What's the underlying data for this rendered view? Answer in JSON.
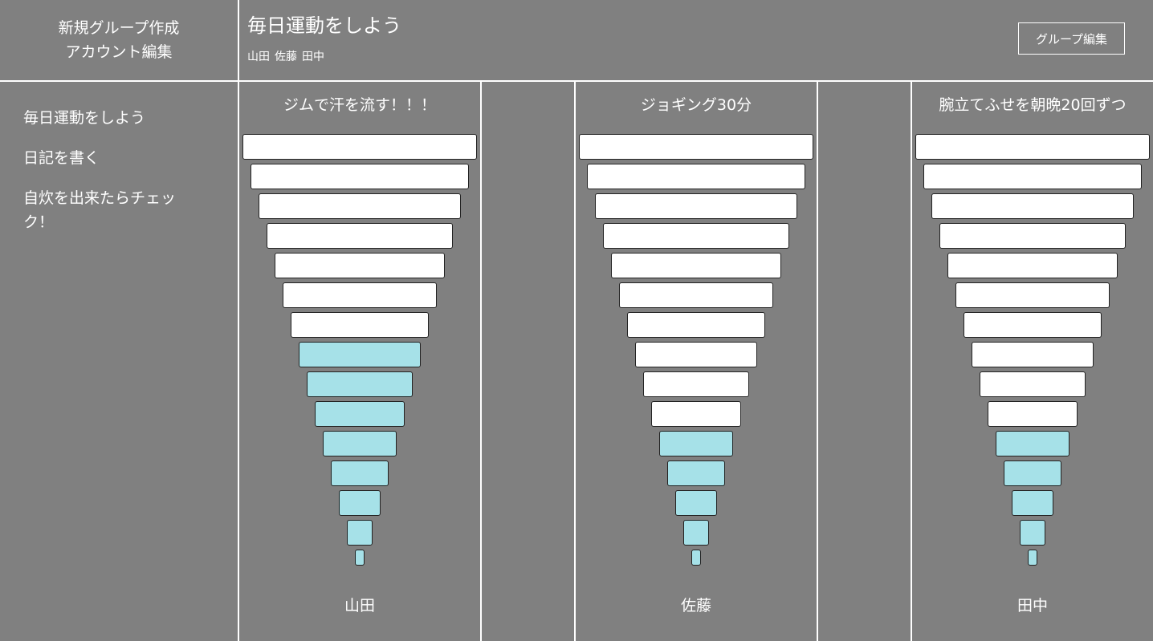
{
  "menu": {
    "new_group": "新規グループ作成",
    "account_edit": "アカウント編集"
  },
  "header": {
    "group_title": "毎日運動をしよう",
    "members": [
      "山田",
      "佐藤",
      "田中"
    ],
    "edit_group_button": "グループ編集"
  },
  "sidebar": {
    "items": [
      {
        "label": "毎日運動をしよう"
      },
      {
        "label": "日記を書く"
      },
      {
        "label": "自炊を出来たらチェック！"
      }
    ]
  },
  "colors": {
    "background": "#808080",
    "line": "#ffffff",
    "step_empty": "#ffffff",
    "step_done": "#a6e1e8"
  },
  "columns": [
    {
      "goal": "ジムで汗を流す！！！",
      "member": "山田",
      "steps_total": 15,
      "steps_done": 8
    },
    {
      "goal": "ジョギング30分",
      "member": "佐藤",
      "steps_total": 15,
      "steps_done": 5
    },
    {
      "goal": "腕立てふせを朝晩20回ずつ",
      "member": "田中",
      "steps_total": 15,
      "steps_done": 5
    }
  ]
}
